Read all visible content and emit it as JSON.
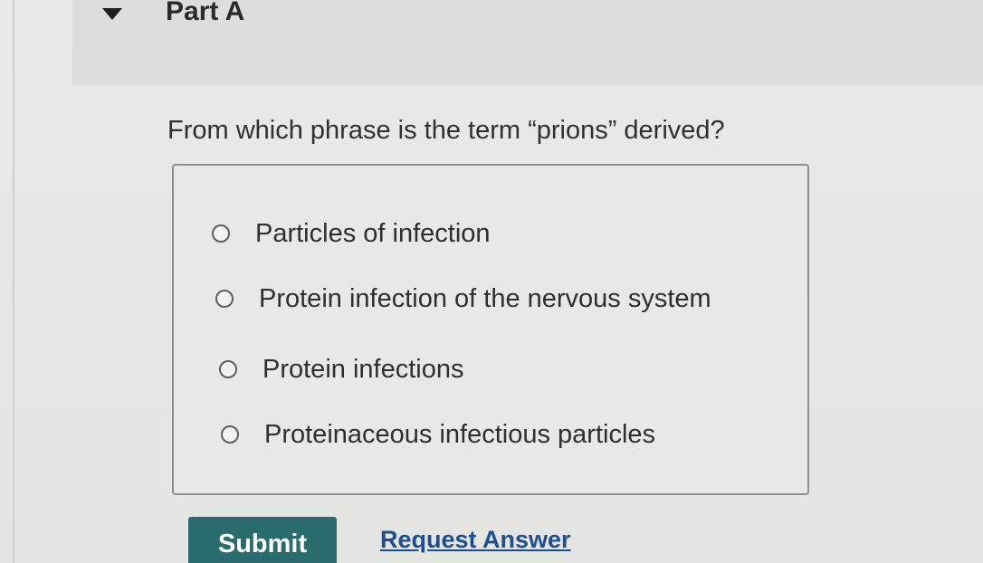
{
  "part": {
    "title": "Part A"
  },
  "question": {
    "text": "From which phrase is the term “prions” derived?"
  },
  "options": [
    {
      "label": "Particles of infection",
      "selected": false
    },
    {
      "label": "Protein infection of the nervous system",
      "selected": false
    },
    {
      "label": "Protein infections",
      "selected": false
    },
    {
      "label": "Proteinaceous infectious particles",
      "selected": false
    }
  ],
  "actions": {
    "submit_label": "Submit",
    "request_answer_label": "Request Answer"
  },
  "colors": {
    "submit_bg": "#2a6b6e",
    "link": "#1f4f8a"
  }
}
